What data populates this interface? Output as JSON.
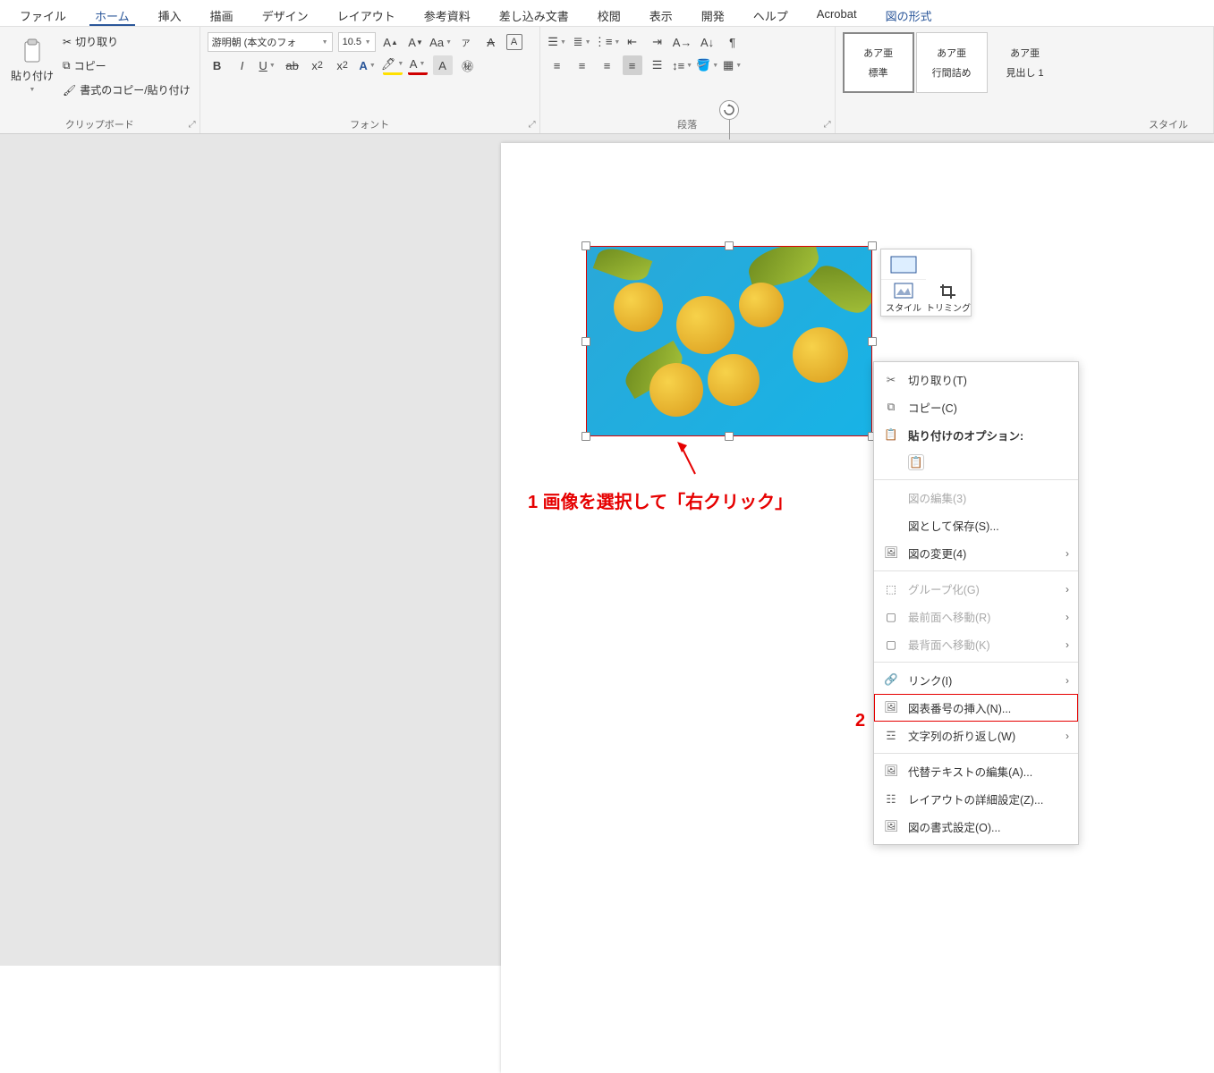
{
  "tabs": {
    "file": "ファイル",
    "home": "ホーム",
    "insert": "挿入",
    "draw": "描画",
    "design": "デザイン",
    "layout": "レイアウト",
    "references": "参考資料",
    "mailings": "差し込み文書",
    "review": "校閲",
    "view": "表示",
    "developer": "開発",
    "help": "ヘルプ",
    "acrobat": "Acrobat",
    "pictureformat": "図の形式"
  },
  "ribbon": {
    "clipboard": {
      "paste": "貼り付け",
      "cut": "切り取り",
      "copy": "コピー",
      "formatpainter": "書式のコピー/貼り付け",
      "group": "クリップボード"
    },
    "font": {
      "name": "游明朝 (本文のフォ",
      "size": "10.5",
      "group": "フォント"
    },
    "paragraph": {
      "group": "段落"
    },
    "styles": {
      "s1": {
        "sample": "あア亜",
        "label": "標準"
      },
      "s2": {
        "sample": "あア亜",
        "label": "行間詰め"
      },
      "s3": {
        "sample": "あア亜",
        "label": "見出し 1"
      },
      "group": "スタイル"
    }
  },
  "mini": {
    "style": "スタイル",
    "crop": "トリミング"
  },
  "annotations": {
    "step1": "1 画像を選択して「右クリック」",
    "step2num": "2"
  },
  "context": {
    "cut": "切り取り(T)",
    "copy": "コピー(C)",
    "pasteoptions": "貼り付けのオプション:",
    "editimg": "図の編集(3)",
    "saveas": "図として保存(S)...",
    "changeimg": "図の変更(4)",
    "group": "グループ化(G)",
    "bringfront": "最前面へ移動(R)",
    "sendback": "最背面へ移動(K)",
    "link": "リンク(I)",
    "insertcaption": "図表番号の挿入(N)...",
    "textwrap": "文字列の折り返し(W)",
    "editalt": "代替テキストの編集(A)...",
    "layoutmore": "レイアウトの詳細設定(Z)...",
    "formatpic": "図の書式設定(O)..."
  }
}
